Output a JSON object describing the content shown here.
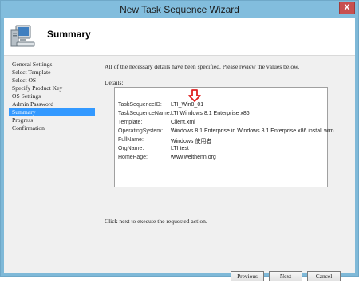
{
  "window": {
    "title": "New Task Sequence Wizard",
    "close_glyph": "X"
  },
  "header": {
    "heading": "Summary",
    "icon": "computer-icon"
  },
  "nav": {
    "items": [
      {
        "label": "General Settings",
        "selected": false
      },
      {
        "label": "Select Template",
        "selected": false
      },
      {
        "label": "Select OS",
        "selected": false
      },
      {
        "label": "Specify Product Key",
        "selected": false
      },
      {
        "label": "OS Settings",
        "selected": false
      },
      {
        "label": "Admin Password",
        "selected": false
      },
      {
        "label": "Summary",
        "selected": true
      },
      {
        "label": "Progress",
        "selected": false
      },
      {
        "label": "Confirmation",
        "selected": false
      }
    ]
  },
  "main": {
    "intro": "All of the necessary details have been specified.  Please review the values below.",
    "details_label": "Details:",
    "details": [
      {
        "key": "TaskSequenceID:",
        "value": "LTI_Win8_01"
      },
      {
        "key": "TaskSequenceName:",
        "value": "LTI Windows 8.1 Enterprise x86"
      },
      {
        "key": "Template:",
        "value": "Client.xml"
      },
      {
        "key": "OperatingSystem:",
        "value": "Windows 8.1 Enterprise in Windows 8.1 Enterprise x86 install.wim"
      },
      {
        "key": "FullName:",
        "value": "Windows 使用者"
      },
      {
        "key": "OrgName:",
        "value": "LTI test"
      },
      {
        "key": "HomePage:",
        "value": "www.weithenn.org"
      }
    ],
    "footer_text": "Click next to execute the requested action."
  },
  "buttons": {
    "previous": "Previous",
    "next": "Next",
    "cancel": "Cancel"
  },
  "colors": {
    "title_bar": "#82bddd",
    "selection": "#3399ff",
    "arrow": "#e02020"
  }
}
